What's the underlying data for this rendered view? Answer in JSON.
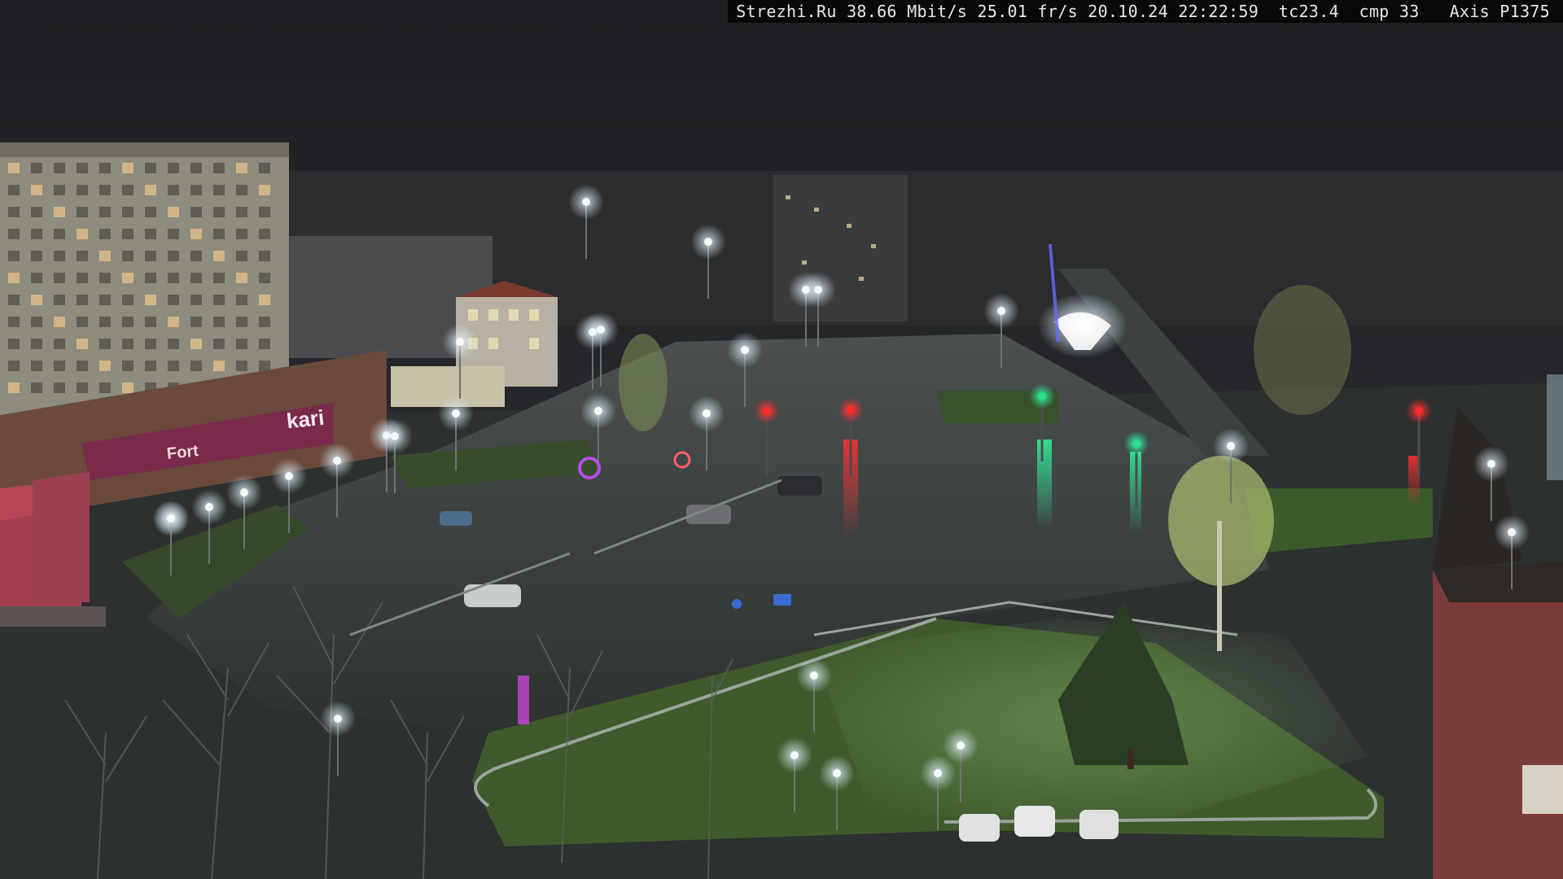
{
  "overlay": {
    "site": "Strezhi.Ru",
    "bitrate": "38.66 Mbit/s",
    "framerate": "25.01 fr/s",
    "date": "20.10.24",
    "time": "22:22:59",
    "tc": "tc23.4",
    "cmp": "cmp 33",
    "camera": "Axis P1375"
  },
  "signs": {
    "store_left": "kari",
    "store_small": "Fort"
  },
  "colors": {
    "sky": "#232427",
    "asphalt": "#3a3f3d",
    "grass": "#3f5a2c",
    "lamp": "#f4fbff",
    "signal_red": "#ff2a2a",
    "signal_green": "#27e08a",
    "shop_facade": "#7a2a4a"
  }
}
